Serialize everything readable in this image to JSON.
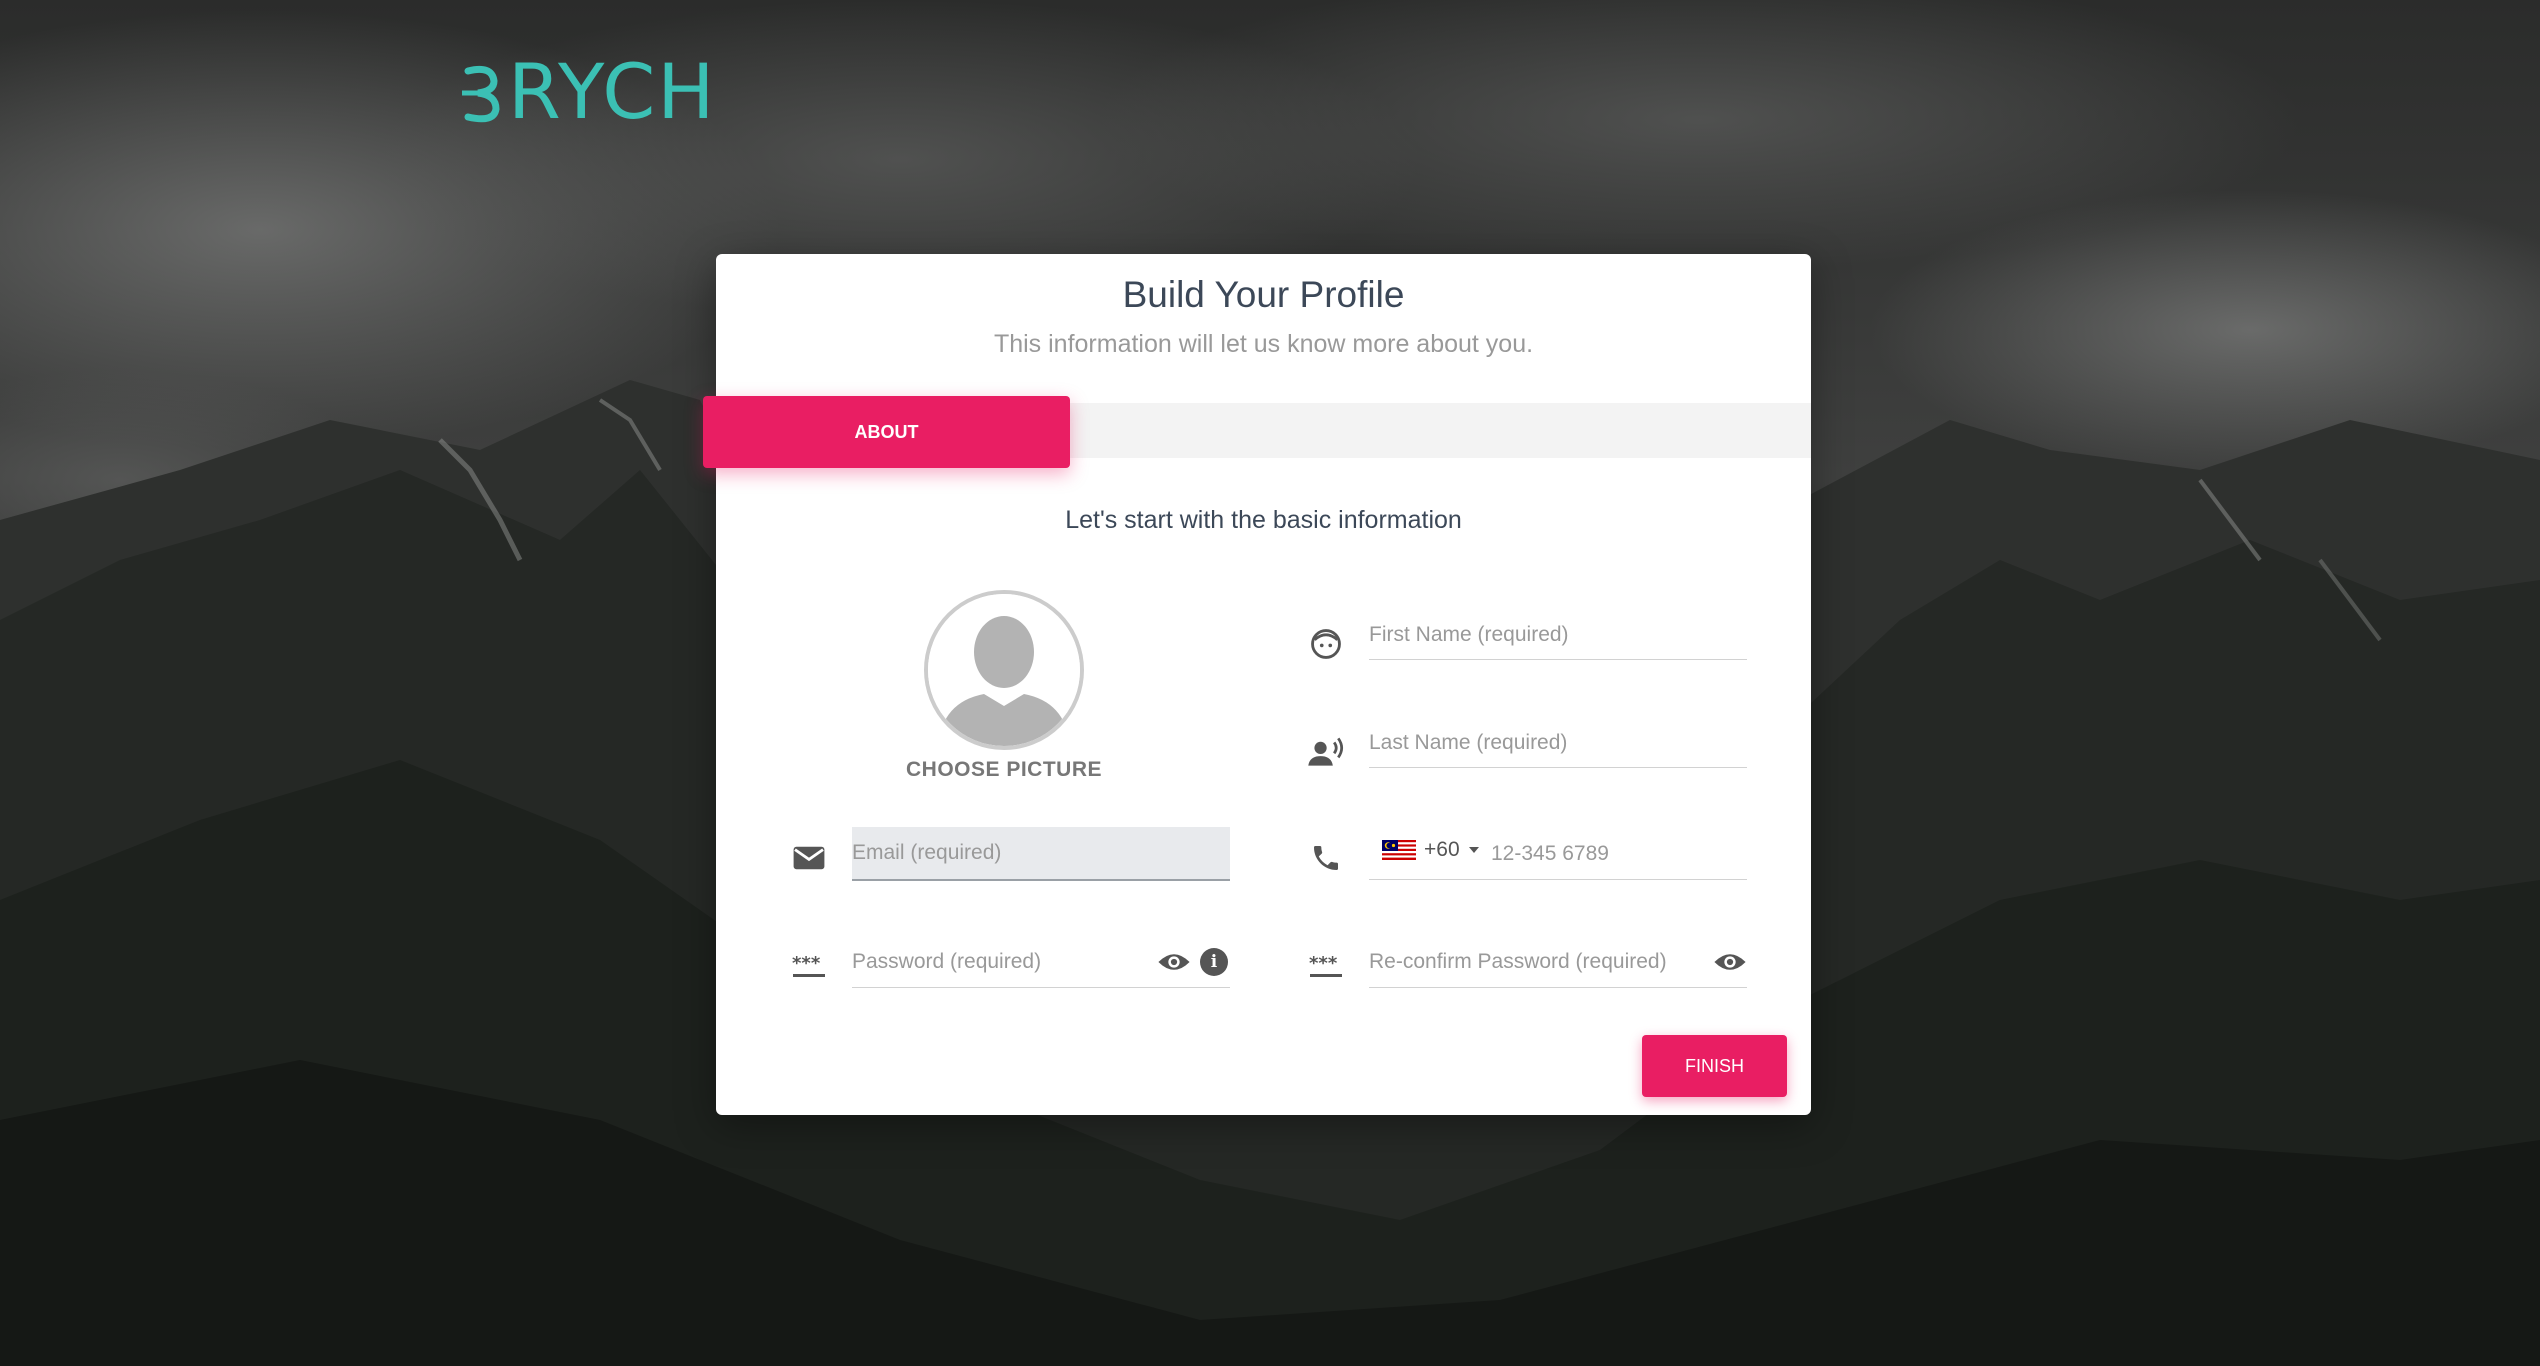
{
  "brand": {
    "logo_text": "RYCH",
    "logo_color": "#3bc0b4"
  },
  "card": {
    "title": "Build Your Profile",
    "subtitle": "This information will let us know more about you."
  },
  "tabs": [
    {
      "label": "ABOUT",
      "active": true
    }
  ],
  "section": {
    "title": "Let's start with the basic information"
  },
  "picture": {
    "label": "CHOOSE PICTURE"
  },
  "fields": {
    "first_name": {
      "placeholder": "First Name (required)",
      "value": "",
      "icon": "face-icon"
    },
    "last_name": {
      "placeholder": "Last Name (required)",
      "value": "",
      "icon": "record-voice-icon"
    },
    "email": {
      "placeholder": "Email (required)",
      "value": "",
      "icon": "email-icon"
    },
    "phone": {
      "country_code": "+60",
      "placeholder": "12-345 6789",
      "value": "",
      "icon": "phone-icon",
      "flag": "malaysia-flag"
    },
    "password": {
      "placeholder": "Password (required)",
      "value": "",
      "icon": "password-icon"
    },
    "reconfirm_password": {
      "placeholder": "Re-confirm Password (required)",
      "value": "",
      "icon": "password-icon"
    }
  },
  "info_glyph": "i",
  "finish_label": "FINISH",
  "colors": {
    "accent": "#e91e63",
    "teal": "#3bc0b4"
  }
}
